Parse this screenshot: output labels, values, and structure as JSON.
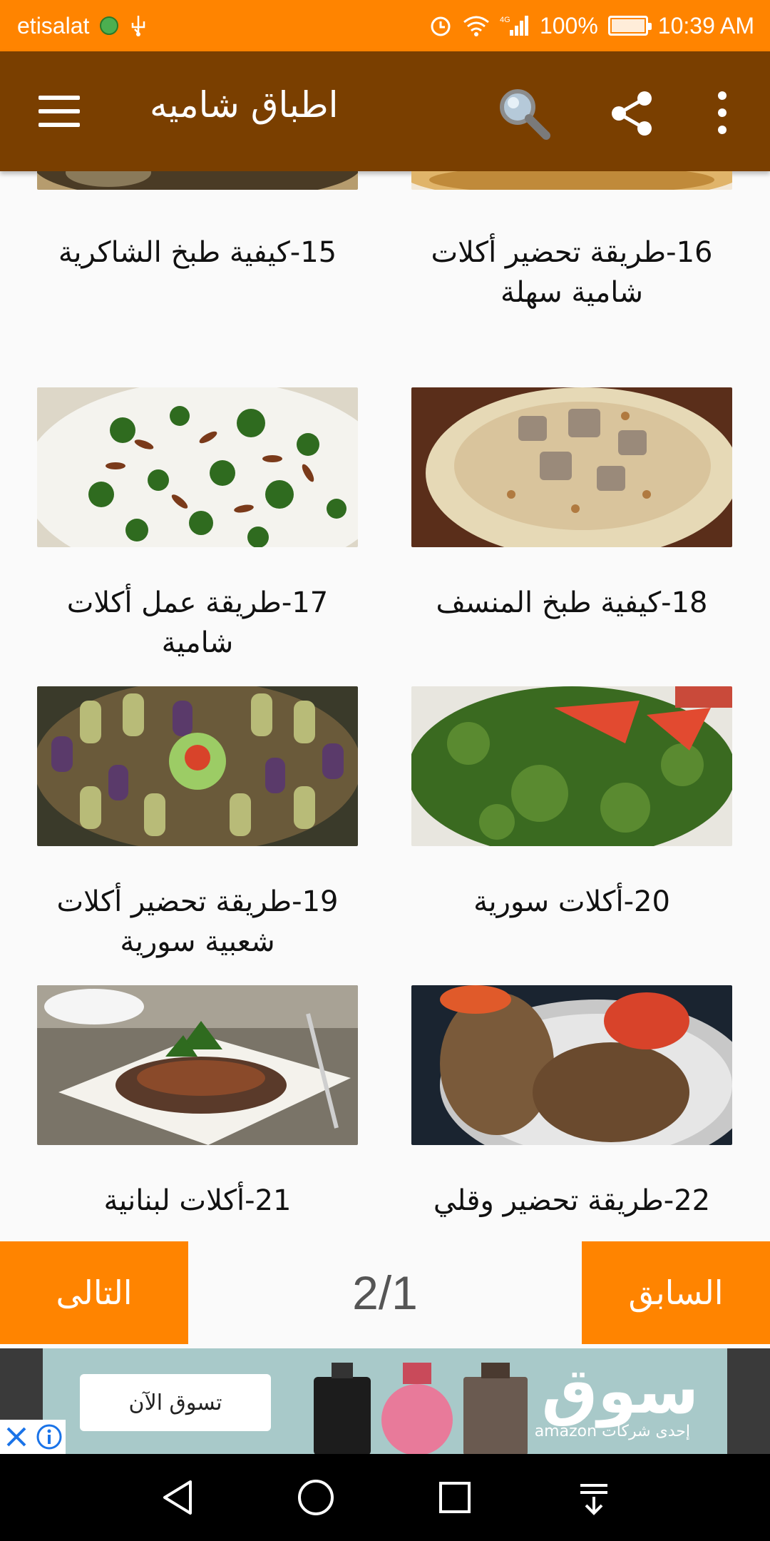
{
  "status_bar": {
    "carrier": "etisalat",
    "network": "4G",
    "battery": "100%",
    "time": "10:39 AM"
  },
  "toolbar": {
    "title": "اطباق شاميه"
  },
  "grid": {
    "items": [
      {
        "caption": "15-كيفية طبخ الشاكرية",
        "image": "rice-yogurt-meat-dish",
        "colors": [
          "#b69c6e",
          "#4a3b25"
        ]
      },
      {
        "caption": "16-طريقة تحضير أكلات شامية سهلة",
        "image": "baked-bread-dish",
        "colors": [
          "#e0b46a",
          "#c08a3a"
        ]
      },
      {
        "caption": "17-طريقة عمل أكلات شامية",
        "image": "fatteh-pine-nuts-parsley",
        "colors": [
          "#f2f2ec",
          "#2f6b1f"
        ]
      },
      {
        "caption": "18-كيفية طبخ المنسف",
        "image": "mansaf-lamb-rice",
        "colors": [
          "#d9c49c",
          "#9a8a7a"
        ]
      },
      {
        "caption": "19-طريقة تحضير أكلات شعبية سورية",
        "image": "stuffed-vegetables-platter",
        "colors": [
          "#8a8a4a",
          "#5a3a5a"
        ]
      },
      {
        "caption": "20-أكلات سورية",
        "image": "tabbouleh-salad",
        "colors": [
          "#3a6a20",
          "#e24a30"
        ]
      },
      {
        "caption": "21-أكلات لبنانية",
        "image": "mujadara-rice-plate",
        "colors": [
          "#e8e4dc",
          "#5a3a2a"
        ]
      },
      {
        "caption": "22-طريقة تحضير وقلي",
        "image": "kibbeh-fried",
        "colors": [
          "#7a5a3a",
          "#c8c8c8"
        ]
      }
    ]
  },
  "pager": {
    "next_label": "التالى",
    "prev_label": "السابق",
    "page_indicator": "2/1"
  },
  "ad": {
    "cta": "تسوق الآن",
    "brand": "سوق",
    "subtitle": "إحدى شركات amazon",
    "colors": {
      "background": "#a8c9c9"
    }
  },
  "colors": {
    "status_bar": "#ff8400",
    "toolbar": "#7a3f00",
    "accent": "#ff8400"
  }
}
